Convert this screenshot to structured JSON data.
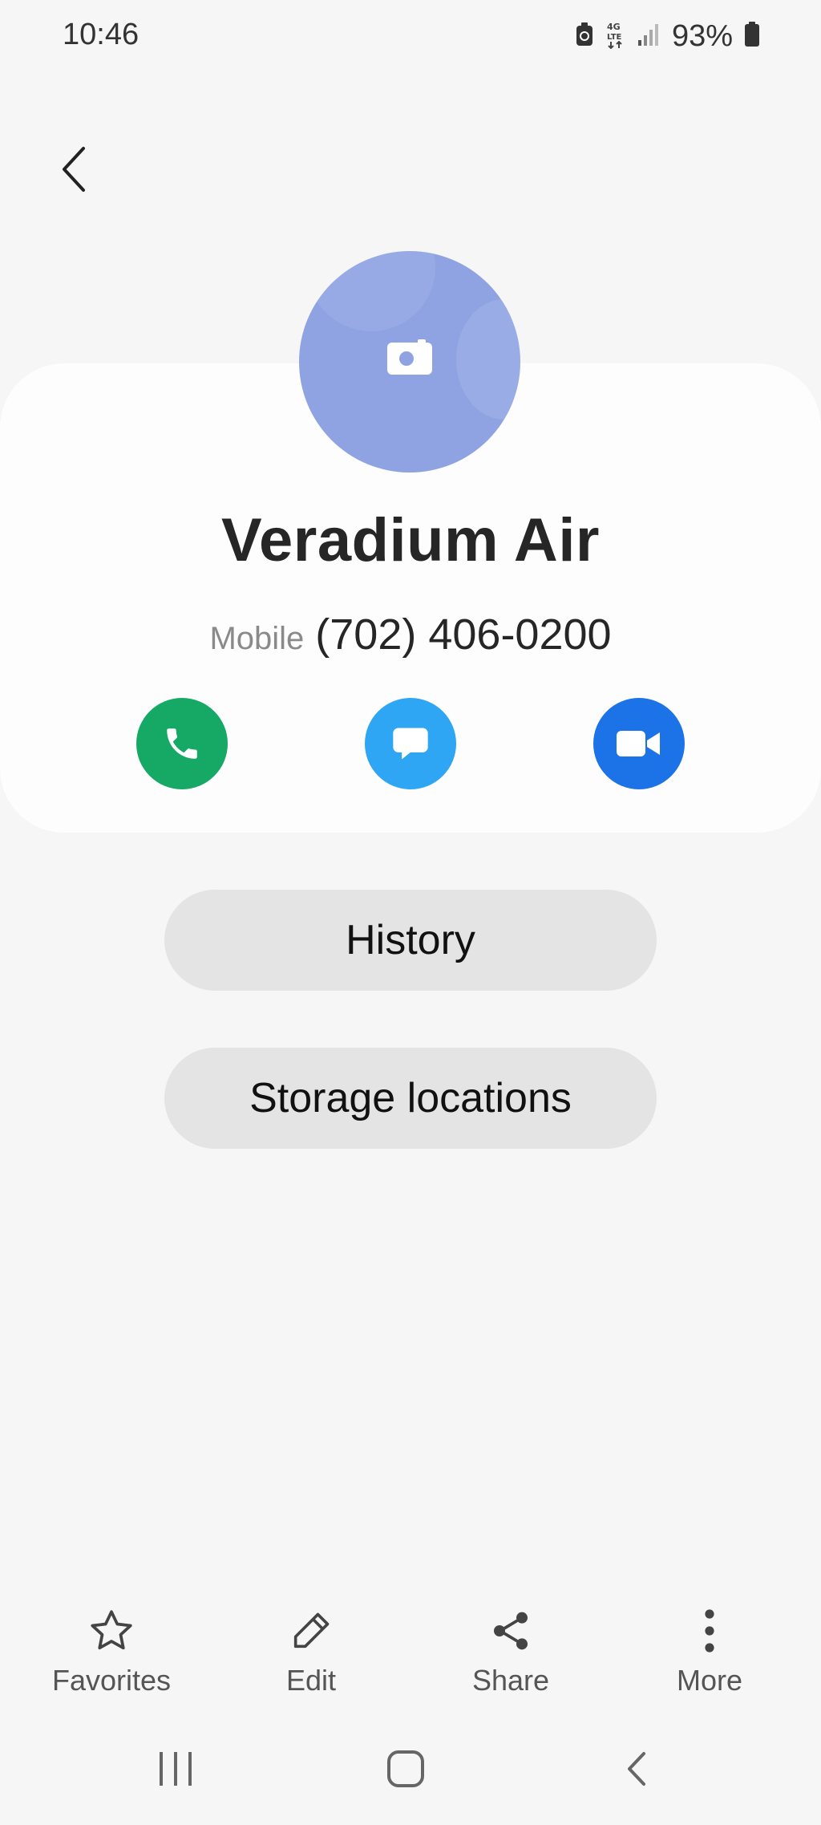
{
  "status_bar": {
    "time": "10:46",
    "battery": "93%",
    "icons": [
      "battery-saver-icon",
      "4g-lte-icon",
      "signal-icon",
      "battery-icon"
    ]
  },
  "contact": {
    "name": "Veradium Air",
    "phone_label": "Mobile",
    "phone_number": "(702) 406-0200",
    "avatar_color": "#8fa3e3"
  },
  "actions": {
    "call_color": "#16a965",
    "message_color": "#2ea6f3",
    "video_color": "#1c73e8"
  },
  "buttons": {
    "history": "History",
    "storage": "Storage locations"
  },
  "bottom_bar": {
    "favorites": "Favorites",
    "edit": "Edit",
    "share": "Share",
    "more": "More"
  }
}
